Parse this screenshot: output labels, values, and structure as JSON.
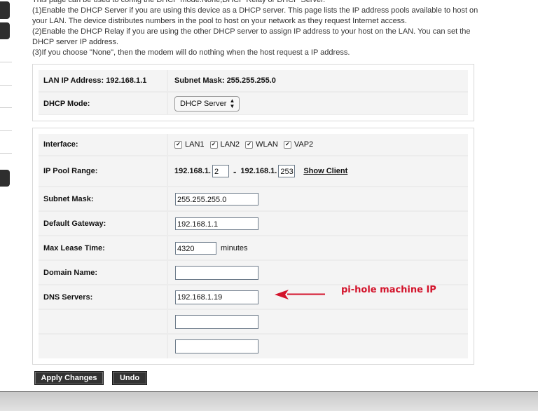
{
  "intro": {
    "line0": "This page can be used to config the DHCP mode:None,DHCP Relay or DHCP Server.",
    "line1": "(1)Enable the DHCP Server if you are using this device as a DHCP server. This page lists the IP address pools available to host on",
    "line2": "your LAN. The device distributes numbers in the pool to host on your network as they request Internet access.",
    "line3": "(2)Enable the DHCP Relay if you are using the other DHCP server to assign IP address to your host on the LAN. You can set the",
    "line4": "DHCP server IP address.",
    "line5": "(3)If you choose \"None\", then the modem will do nothing when the host request a IP address."
  },
  "top_box": {
    "lan_ip": "LAN IP Address: 192.168.1.1",
    "subnet": "Subnet Mask: 255.255.255.0",
    "dhcp_mode_label": "DHCP Mode:",
    "dhcp_mode_value": "DHCP Server"
  },
  "form": {
    "interface_label": "Interface:",
    "interfaces": [
      "LAN1",
      "LAN2",
      "WLAN",
      "VAP2"
    ],
    "pool_label": "IP Pool Range:",
    "pool_prefix_start": "192.168.1.",
    "pool_start": "2",
    "pool_prefix_end": "192.168.1.",
    "pool_end": "253",
    "show_client": "Show Client",
    "subnet_label": "Subnet Mask:",
    "subnet_value": "255.255.255.0",
    "gateway_label": "Default Gateway:",
    "gateway_value": "192.168.1.1",
    "lease_label": "Max Lease Time:",
    "lease_value": "4320",
    "lease_unit": "minutes",
    "domain_label": "Domain Name:",
    "domain_value": "",
    "dns_label": "DNS Servers:",
    "dns1": "192.168.1.19",
    "dns2": "",
    "dns3": ""
  },
  "buttons": {
    "apply": "Apply Changes",
    "undo": "Undo"
  },
  "annotation": {
    "text": "pi-hole machine IP",
    "color": "#d3132b"
  }
}
